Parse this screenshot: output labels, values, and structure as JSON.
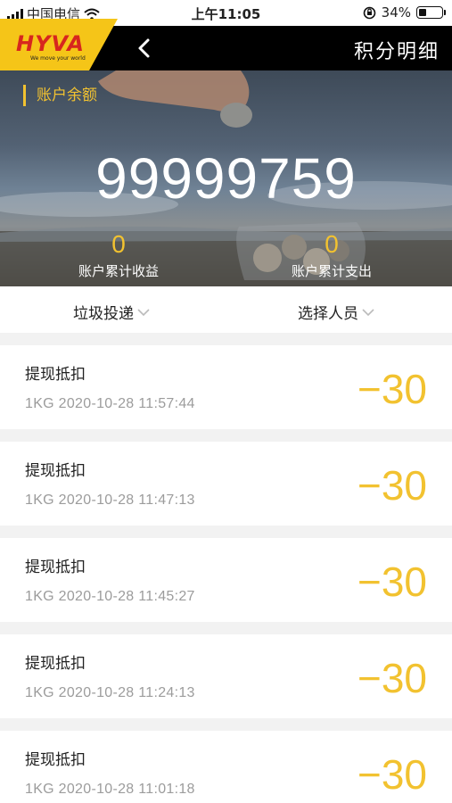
{
  "status_bar": {
    "carrier": "中国电信",
    "time": "上午11:05",
    "battery_percent": "34%",
    "battery_level": 0.34
  },
  "nav": {
    "logo_text": "HYVA",
    "logo_tagline": "We move your world",
    "back_icon": "chevron-left-icon",
    "title": "积分明细"
  },
  "account": {
    "balance_label": "账户余额",
    "balance": "99999759",
    "income_value": "0",
    "income_label": "账户累计收益",
    "expense_value": "0",
    "expense_label": "账户累计支出"
  },
  "filters": {
    "category": "垃圾投递",
    "person": "选择人员"
  },
  "records": [
    {
      "title": "提现抵扣",
      "meta": "1KG 2020-10-28 11:57:44",
      "amount": "−30"
    },
    {
      "title": "提现抵扣",
      "meta": "1KG 2020-10-28 11:47:13",
      "amount": "−30"
    },
    {
      "title": "提现抵扣",
      "meta": "1KG 2020-10-28 11:45:27",
      "amount": "−30"
    },
    {
      "title": "提现抵扣",
      "meta": "1KG 2020-10-28 11:24:13",
      "amount": "−30"
    },
    {
      "title": "提现抵扣",
      "meta": "1KG 2020-10-28 11:01:18",
      "amount": "−30"
    }
  ],
  "colors": {
    "accent": "#f2c230",
    "nav_background": "#000000",
    "logo_yellow": "#f5c518",
    "logo_red": "#d7261e"
  }
}
